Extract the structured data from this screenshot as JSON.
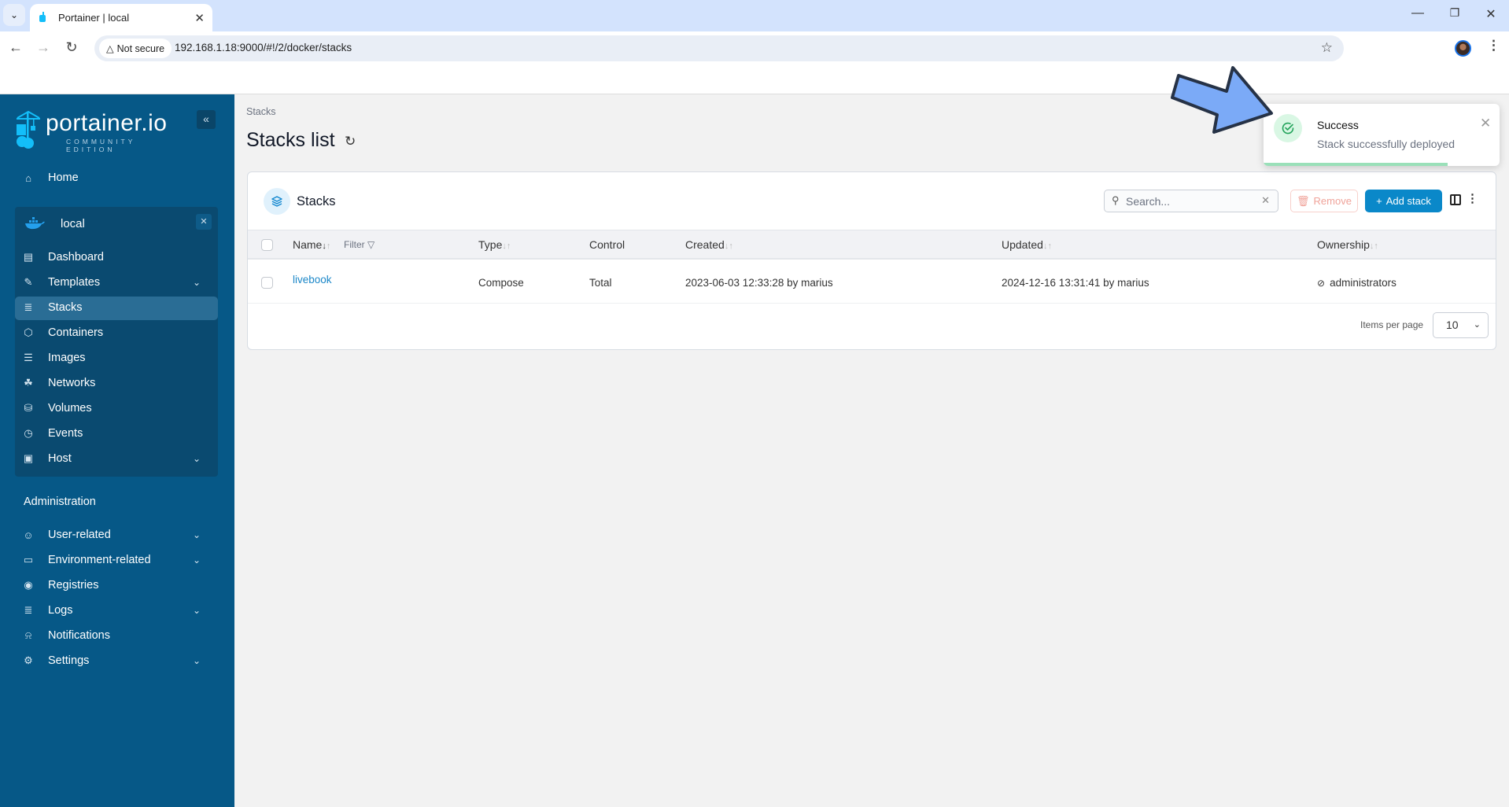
{
  "browser": {
    "tab_title": "Portainer | local",
    "security_label": "Not secure",
    "url": "192.168.1.18:9000/#!/2/docker/stacks"
  },
  "sidebar": {
    "logo_text": "portainer.io",
    "logo_subtitle": "COMMUNITY EDITION",
    "home": "Home",
    "environment": {
      "name": "local",
      "items": [
        {
          "label": "Dashboard",
          "icon": "dashboard-icon",
          "chevron": false
        },
        {
          "label": "Templates",
          "icon": "edit-icon",
          "chevron": true
        },
        {
          "label": "Stacks",
          "icon": "layers-icon",
          "chevron": false,
          "active": true
        },
        {
          "label": "Containers",
          "icon": "box-icon",
          "chevron": false
        },
        {
          "label": "Images",
          "icon": "list-icon",
          "chevron": false
        },
        {
          "label": "Networks",
          "icon": "network-icon",
          "chevron": false
        },
        {
          "label": "Volumes",
          "icon": "database-icon",
          "chevron": false
        },
        {
          "label": "Events",
          "icon": "clock-icon",
          "chevron": false
        },
        {
          "label": "Host",
          "icon": "host-icon",
          "chevron": true
        }
      ]
    },
    "admin_label": "Administration",
    "admin_items": [
      {
        "label": "User-related",
        "icon": "users-icon",
        "chevron": true
      },
      {
        "label": "Environment-related",
        "icon": "drive-icon",
        "chevron": true
      },
      {
        "label": "Registries",
        "icon": "radio-icon",
        "chevron": false
      },
      {
        "label": "Logs",
        "icon": "file-icon",
        "chevron": true
      },
      {
        "label": "Notifications",
        "icon": "bell-icon",
        "chevron": false
      },
      {
        "label": "Settings",
        "icon": "gear-icon",
        "chevron": true
      }
    ]
  },
  "main": {
    "breadcrumb": "Stacks",
    "title": "Stacks list",
    "card_title": "Stacks",
    "search_placeholder": "Search...",
    "remove_label": "Remove",
    "add_label": "Add stack",
    "columns": {
      "name": "Name",
      "filter": "Filter",
      "type": "Type",
      "control": "Control",
      "created": "Created",
      "updated": "Updated",
      "ownership": "Ownership"
    },
    "rows": [
      {
        "name": "livebook",
        "type": "Compose",
        "control": "Total",
        "created": "2023-06-03 12:33:28 by marius",
        "updated": "2024-12-16 13:31:41 by marius",
        "ownership": "administrators"
      }
    ],
    "items_per_page_label": "Items per page",
    "items_per_page": "10"
  },
  "toast": {
    "title": "Success",
    "message": "Stack successfully deployed",
    "progress": 0.78
  },
  "colors": {
    "sidebar_bg": "#065887",
    "accent": "#0a88c9",
    "success": "#22a35a",
    "annotation_arrow": "#7baaf7"
  }
}
